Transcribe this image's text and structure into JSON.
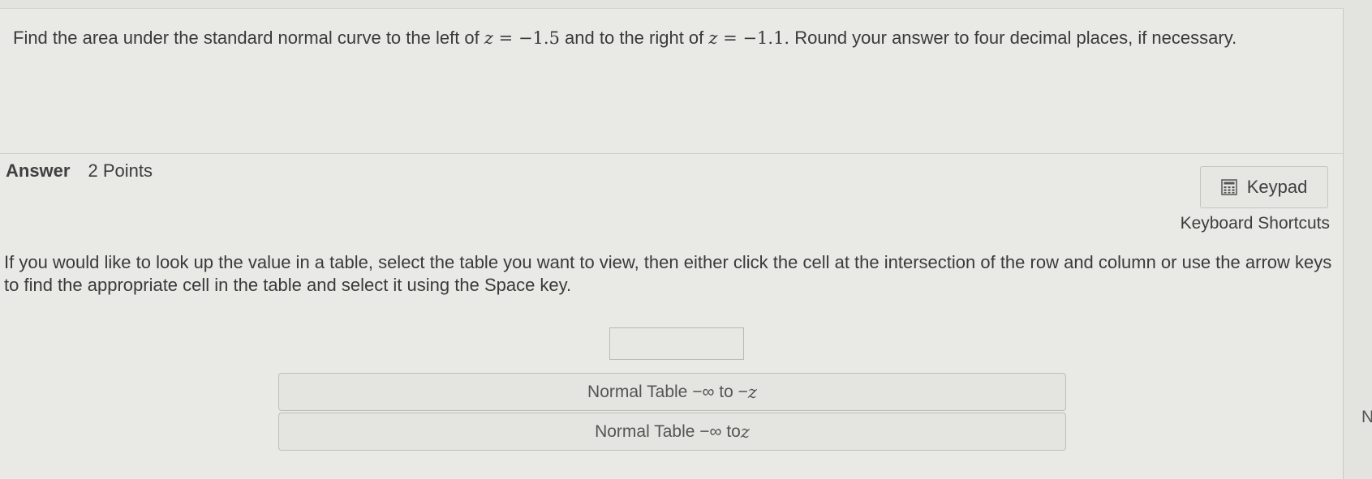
{
  "question": {
    "text_before": "Find the area under the standard normal curve to the left of ",
    "z1_var": "z",
    "z1_eq": " = ",
    "z1_val": "−1.5",
    "text_mid": " and to the right of ",
    "z2_var": "z",
    "z2_eq": " = ",
    "z2_val": "−1.1.",
    "text_after": " Round your answer to four decimal places, if necessary."
  },
  "answer": {
    "label": "Answer",
    "points": "2 Points"
  },
  "keypad": {
    "label": "Keypad",
    "icon": "calculator-icon"
  },
  "shortcuts": {
    "label": "Keyboard Shortcuts"
  },
  "instructions": {
    "text": "If you would like to look up the value in a table, select the table you want to view, then either click the cell at the intersection of the row and column or use the arrow keys to find the appropriate cell in the table and select it using the Space key."
  },
  "answer_input": {
    "value": ""
  },
  "tables": [
    {
      "label_prefix": "Normal Table −∞ to −",
      "var": "z"
    },
    {
      "label_prefix": "Normal Table −∞ to ",
      "var": "z"
    }
  ],
  "edge_text": "N"
}
